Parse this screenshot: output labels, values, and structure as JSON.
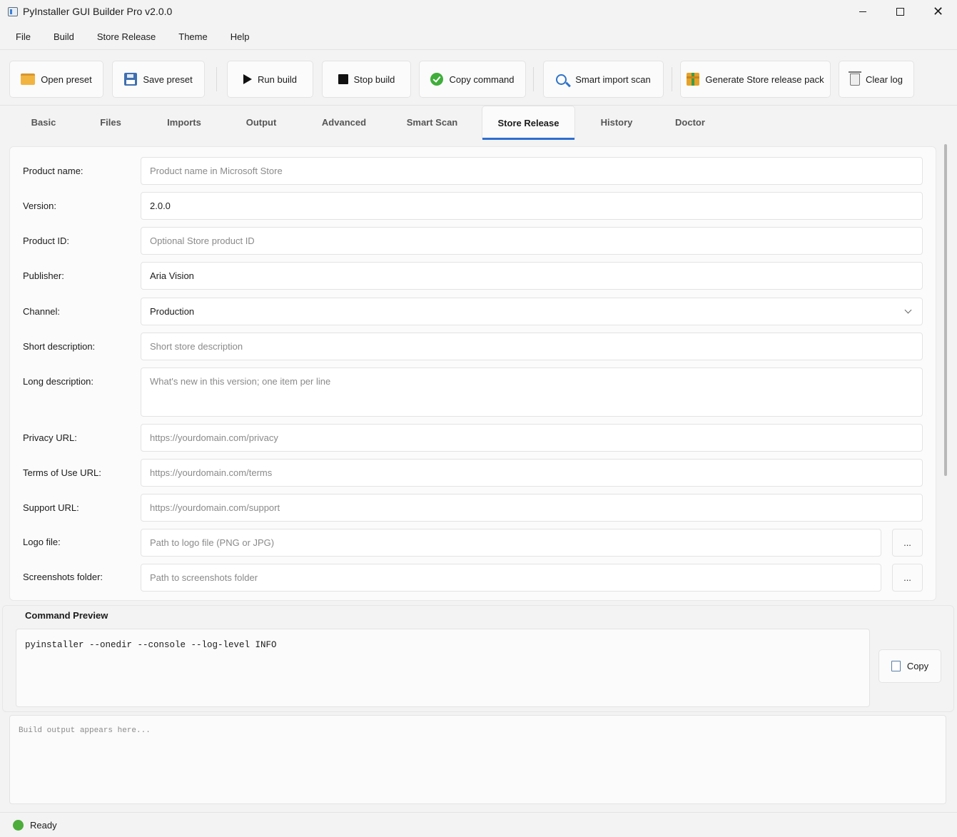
{
  "window": {
    "title": "PyInstaller GUI Builder Pro v2.0.0",
    "controls": {
      "minimize": "",
      "maximize": "",
      "close": "✕"
    }
  },
  "menu": [
    "File",
    "Build",
    "Store Release",
    "Theme",
    "Help"
  ],
  "toolbar": {
    "open_preset": "Open preset",
    "save_preset": "Save preset",
    "run_build": "Run build",
    "stop_build": "Stop build",
    "copy_command": "Copy command",
    "smart_import_scan": "Smart import scan",
    "generate_store_release_pack": "Generate Store release pack",
    "clear_log": "Clear log"
  },
  "tabs": [
    "Basic",
    "Files",
    "Imports",
    "Output",
    "Advanced",
    "Smart Scan",
    "Store Release",
    "History",
    "Doctor"
  ],
  "active_tab": "Store Release",
  "form": {
    "product_name": {
      "label": "Product name:",
      "value": "",
      "placeholder": "Product name in Microsoft Store"
    },
    "version": {
      "label": "Version:",
      "value": "2.0.0",
      "placeholder": ""
    },
    "product_id": {
      "label": "Product ID:",
      "value": "",
      "placeholder": "Optional Store product ID"
    },
    "publisher": {
      "label": "Publisher:",
      "value": "Aria Vision",
      "placeholder": ""
    },
    "channel": {
      "label": "Channel:",
      "value": "Production"
    },
    "short_description": {
      "label": "Short description:",
      "value": "",
      "placeholder": "Short store description"
    },
    "long_description": {
      "label": "Long description:",
      "value": "",
      "placeholder": "What's new in this version; one item per line"
    },
    "privacy_url": {
      "label": "Privacy URL:",
      "value": "",
      "placeholder": "https://yourdomain.com/privacy"
    },
    "terms_url": {
      "label": "Terms of Use URL:",
      "value": "",
      "placeholder": "https://yourdomain.com/terms"
    },
    "support_url": {
      "label": "Support URL:",
      "value": "",
      "placeholder": "https://yourdomain.com/support"
    },
    "logo_file": {
      "label": "Logo file:",
      "value": "",
      "placeholder": "Path to logo file (PNG or JPG)",
      "browse_label": "..."
    },
    "screenshots_folder": {
      "label": "Screenshots folder:",
      "value": "",
      "placeholder": "Path to screenshots folder",
      "browse_label": "..."
    }
  },
  "command_preview": {
    "title": "Command Preview",
    "command": "pyinstaller --onedir --console --log-level INFO",
    "copy_label": "Copy"
  },
  "log": {
    "placeholder": "Build output appears here..."
  },
  "status": {
    "text": "Ready",
    "color": "#4cad3a"
  },
  "colors": {
    "accent": "#2f6fd0",
    "background": "#f3f3f3",
    "surface": "#fbfbfb"
  }
}
